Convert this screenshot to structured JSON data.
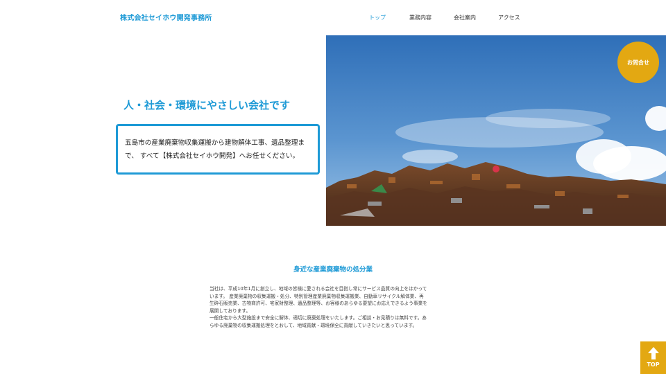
{
  "header": {
    "logo": "株式会社セイホウ開発事務所",
    "nav": [
      {
        "label": "トップ",
        "active": true
      },
      {
        "label": "業務内容",
        "active": false
      },
      {
        "label": "会社案内",
        "active": false
      },
      {
        "label": "アクセス",
        "active": false
      }
    ]
  },
  "hero": {
    "contact_label": "お問合せ",
    "tagline": "人・社会・環境にやさしい会社です",
    "message_lines": [
      "五島市の産業廃棄物収集運搬から建物解体工事、遺品整理ま",
      "で、 すべて【株式会社セイホウ開発】へお任せください。"
    ]
  },
  "intro": {
    "title": "身近な産業廃棄物の処分業",
    "lines": [
      "当社は、平成10年1月に創立し、地域の皆様に愛される会社を目指し常にサービス品質の向上をはかって",
      "います。 産業廃棄物の収集運搬・処分、特別管理産業廃棄物収集運搬業、自動車リサイクル解体業、再",
      "生砕石販売業、古物商許可、宅家財整理、遺品整理等、お客様のあらゆる要望にお応えできるよう事業を",
      "展開しております。",
      "一般住宅から大型施設まで安全に解体、適切に廃棄処理をいたします。ご相談・お見積りは無料です。あ",
      "らゆる廃棄物の収集運搬処理をとおして、地域貢献・環境保全に貢献していきたいと思っています。"
    ]
  },
  "page_top": {
    "label": "TOP"
  },
  "colors": {
    "accent": "#1e9ad6",
    "button": "#e3a812"
  }
}
